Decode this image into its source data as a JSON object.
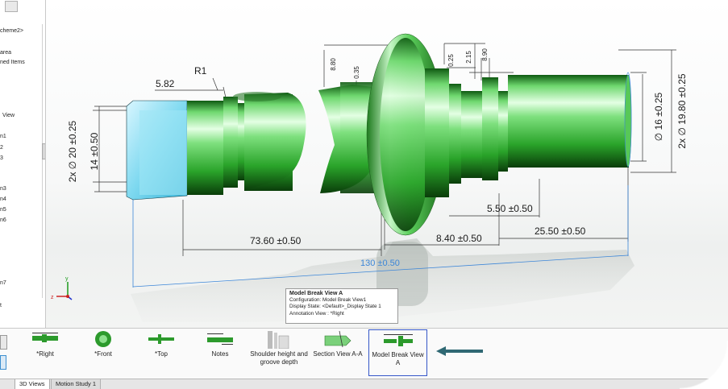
{
  "tree": {
    "items": [
      "cheme2>",
      "area",
      "ned Items",
      "View",
      "n1",
      "2",
      "3",
      "n3",
      "n4",
      "n5",
      "n6",
      "n7",
      "t"
    ]
  },
  "dimensions": {
    "d_582": "5.82",
    "d_r1": "R1",
    "d_880": "8.80",
    "d_035": "0.35",
    "d_025": "0.25",
    "d_215": "2.15",
    "d_890": "8.90",
    "d_14": "14 ±0.50",
    "d_20": "2x ∅ 20 ±0.25",
    "d_16": "∅ 16 ±0.25",
    "d_1980": "2x ∅ 19.80 ±0.25",
    "d_7360": "73.60 ±0.50",
    "d_840": "8.40 ±0.50",
    "d_550": "5.50 ±0.50",
    "d_2550": "25.50 ±0.50",
    "d_130": "130 ±0.50"
  },
  "tooltip": {
    "title": "Model Break View A",
    "configuration": "Configuration:  Model Break View1",
    "display_state": "Display State:  <Default>_Display State 1",
    "annotation_view": "Annotation View :  *Right"
  },
  "views": [
    {
      "label": "*Right"
    },
    {
      "label": "*Front"
    },
    {
      "label": "*Top"
    },
    {
      "label": "Notes"
    },
    {
      "label": "Shoulder height and groove depth"
    },
    {
      "label": "Section View A-A"
    },
    {
      "label": "Model Break View A"
    }
  ],
  "tabs": {
    "active": "3D Views",
    "other": "Motion Study 1"
  },
  "triad": {
    "x": "x",
    "y": "y",
    "z": "z"
  },
  "colors": {
    "accent": "#3556c8",
    "arrow": "#2f6873",
    "shaft": "#3dbd3d"
  }
}
